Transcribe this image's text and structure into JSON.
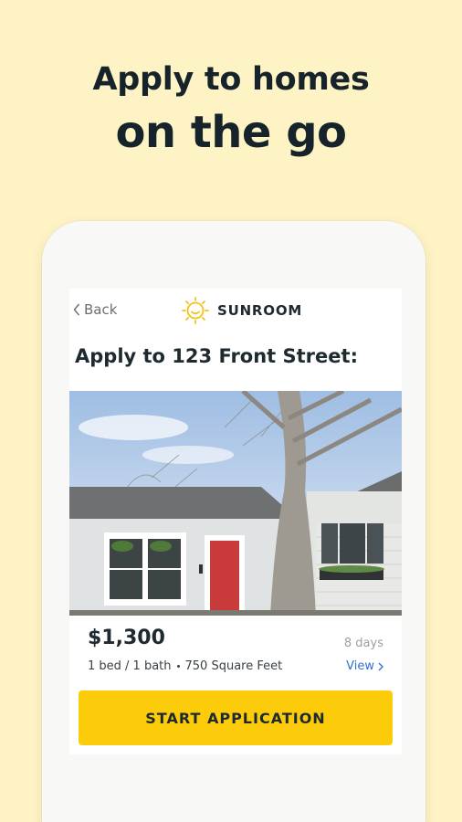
{
  "headline": {
    "line1": "Apply to homes",
    "line2": "on the go"
  },
  "nav": {
    "back_label": "Back",
    "brand_name": "SUNROOM"
  },
  "listing": {
    "title": "Apply to 123 Front Street:",
    "price": "$1,300",
    "posted": "8 days",
    "beds_baths": "1 bed / 1 bath",
    "area": "750 Square Feet",
    "view_label": "View"
  },
  "cta": {
    "label": "START APPLICATION"
  },
  "colors": {
    "background": "#fdf3c4",
    "accent": "#fccc0a",
    "link": "#2f6fd6",
    "logo": "#f2c316"
  },
  "icons": {
    "back": "chevron-left-icon",
    "logo": "sun-logo-icon",
    "view": "chevron-right-icon"
  }
}
